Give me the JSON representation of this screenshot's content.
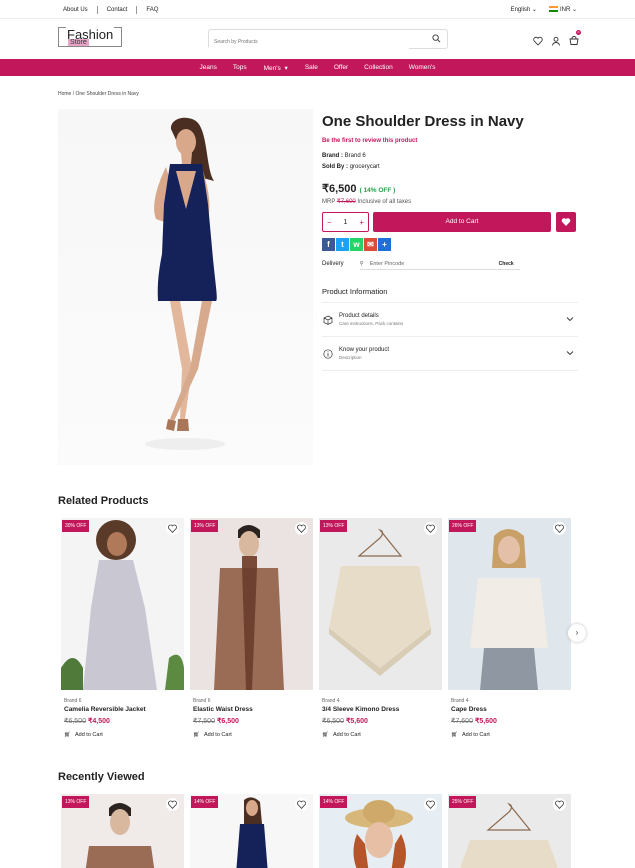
{
  "topbar": {
    "links": [
      "About Us",
      "Contact",
      "FAQ"
    ],
    "language": "English",
    "currency": "INR"
  },
  "header": {
    "logo_main": "Fashion",
    "logo_sub": "Store",
    "search_placeholder": "Search by Products",
    "cart_count": "0"
  },
  "nav": [
    "Jeans",
    "Tops",
    "Men's",
    "Sale",
    "Offer",
    "Collection",
    "Women's"
  ],
  "breadcrumb": {
    "home": "Home",
    "sep": "/",
    "current": "One Shoulder Dress in Navy"
  },
  "product": {
    "title": "One Shoulder Dress in Navy",
    "review_prompt": "Be the first to review this product",
    "brand_label": "Brand :",
    "brand": "Brand 6",
    "sold_label": "Sold By :",
    "sold_by": "grocerycart",
    "price": "₹6,500",
    "discount": "( 14% OFF )",
    "mrp_label": "MRP",
    "mrp": "₹7,600",
    "tax_note": "Inclusive of all taxes",
    "qty": "1",
    "add_to_cart": "Add to Cart",
    "delivery_label": "Delivery",
    "pincode_placeholder": "Enter Pincode",
    "check": "Check",
    "info_heading": "Product Information",
    "details_title": "Product details",
    "details_sub": "Care instructions, Pack contains",
    "know_title": "Know your product",
    "know_sub": "Description"
  },
  "related": {
    "heading": "Related Products",
    "items": [
      {
        "badge": "30% OFF",
        "brand": "Brand 6",
        "name": "Camelia Reversible Jacket",
        "mrp": "₹6,500",
        "price": "₹4,500",
        "cta": "Add to Cart"
      },
      {
        "badge": "13% OFF",
        "brand": "Brand 6",
        "name": "Elastic Waist Dress",
        "mrp": "₹7,500",
        "price": "₹6,500",
        "cta": "Add to Cart"
      },
      {
        "badge": "13% OFF",
        "brand": "Brand 4",
        "name": "3/4 Sleeve Kimono Dress",
        "mrp": "₹6,500",
        "price": "₹5,600",
        "cta": "Add to Cart"
      },
      {
        "badge": "26% OFF",
        "brand": "Brand 4",
        "name": "Cape Dress",
        "mrp": "₹7,600",
        "price": "₹5,600",
        "cta": "Add to Cart"
      }
    ]
  },
  "recent": {
    "heading": "Recently Viewed",
    "badges": [
      "13% OFF",
      "14% OFF",
      "14% OFF",
      "25% OFF"
    ]
  },
  "colors": {
    "accent": "#c2185b",
    "discount_green": "#2a9d4a"
  }
}
